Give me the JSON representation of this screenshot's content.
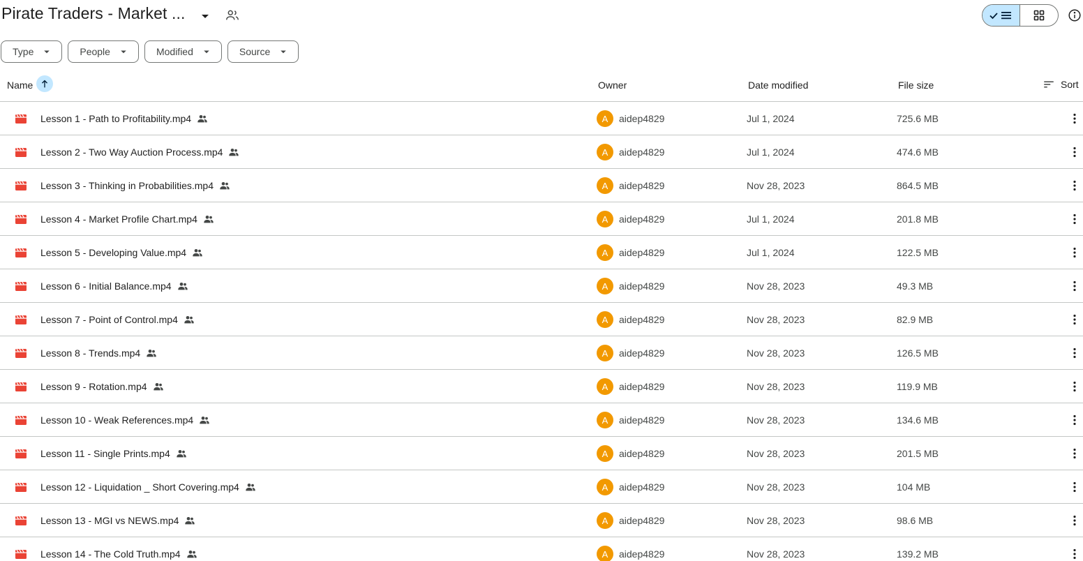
{
  "header": {
    "title": "Pirate Traders - Market ...",
    "icons": {
      "caret": "arrow-drop-down-icon",
      "shared": "shared-folder-icon",
      "info": "info-icon"
    }
  },
  "view_toggle": {
    "active": "list",
    "list_icon": "check-list-icon",
    "grid_icon": "grid-icon"
  },
  "filters": [
    {
      "label": "Type"
    },
    {
      "label": "People"
    },
    {
      "label": "Modified"
    },
    {
      "label": "Source"
    }
  ],
  "table": {
    "columns": {
      "name": "Name",
      "owner": "Owner",
      "date": "Date modified",
      "size": "File size",
      "sort": "Sort"
    },
    "sort_direction": "ascending",
    "rows": [
      {
        "name": "Lesson 1 - Path to Profitability.mp4",
        "avatar": "A",
        "owner": "aidep4829",
        "date": "Jul 1, 2024",
        "size": "725.6 MB"
      },
      {
        "name": "Lesson 2 - Two Way Auction Process.mp4",
        "avatar": "A",
        "owner": "aidep4829",
        "date": "Jul 1, 2024",
        "size": "474.6 MB"
      },
      {
        "name": "Lesson 3 - Thinking in Probabilities.mp4",
        "avatar": "A",
        "owner": "aidep4829",
        "date": "Nov 28, 2023",
        "size": "864.5 MB"
      },
      {
        "name": "Lesson 4 - Market Profile Chart.mp4",
        "avatar": "A",
        "owner": "aidep4829",
        "date": "Jul 1, 2024",
        "size": "201.8 MB"
      },
      {
        "name": "Lesson 5 - Developing Value.mp4",
        "avatar": "A",
        "owner": "aidep4829",
        "date": "Jul 1, 2024",
        "size": "122.5 MB"
      },
      {
        "name": "Lesson 6 - Initial Balance.mp4",
        "avatar": "A",
        "owner": "aidep4829",
        "date": "Nov 28, 2023",
        "size": "49.3 MB"
      },
      {
        "name": "Lesson 7 - Point of Control.mp4",
        "avatar": "A",
        "owner": "aidep4829",
        "date": "Nov 28, 2023",
        "size": "82.9 MB"
      },
      {
        "name": "Lesson 8 - Trends.mp4",
        "avatar": "A",
        "owner": "aidep4829",
        "date": "Nov 28, 2023",
        "size": "126.5 MB"
      },
      {
        "name": "Lesson 9 - Rotation.mp4",
        "avatar": "A",
        "owner": "aidep4829",
        "date": "Nov 28, 2023",
        "size": "119.9 MB"
      },
      {
        "name": "Lesson 10 - Weak References.mp4",
        "avatar": "A",
        "owner": "aidep4829",
        "date": "Nov 28, 2023",
        "size": "134.6 MB"
      },
      {
        "name": "Lesson 11 - Single Prints.mp4",
        "avatar": "A",
        "owner": "aidep4829",
        "date": "Nov 28, 2023",
        "size": "201.5 MB"
      },
      {
        "name": "Lesson 12 - Liquidation _ Short Covering.mp4",
        "avatar": "A",
        "owner": "aidep4829",
        "date": "Nov 28, 2023",
        "size": "104 MB"
      },
      {
        "name": "Lesson 13 - MGI vs NEWS.mp4",
        "avatar": "A",
        "owner": "aidep4829",
        "date": "Nov 28, 2023",
        "size": "98.6 MB"
      },
      {
        "name": "Lesson 14 - The Cold Truth.mp4",
        "avatar": "A",
        "owner": "aidep4829",
        "date": "Nov 28, 2023",
        "size": "139.2 MB"
      }
    ]
  },
  "colors": {
    "video_icon": "#ea4335",
    "avatar_bg": "#f29900",
    "toggle_active": "#c2e7ff",
    "divider": "#c4c7c5"
  }
}
